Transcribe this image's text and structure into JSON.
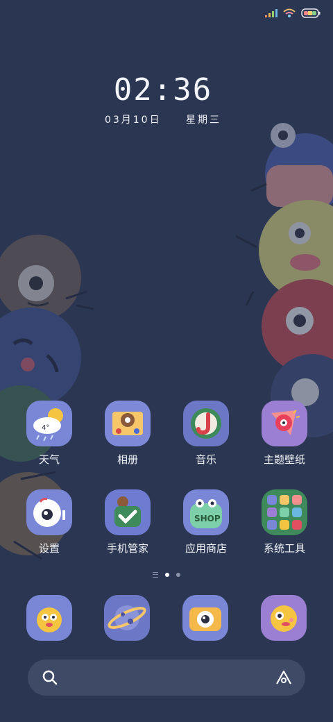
{
  "status_bar": {
    "signal_icon": "signal-icon",
    "wifi_icon": "wifi-icon",
    "battery_icon": "battery-icon"
  },
  "clock": {
    "time": "02:36",
    "date": "03月10日",
    "weekday": "星期三"
  },
  "apps": [
    {
      "label": "天气",
      "icon": "weather-icon",
      "color": "#7a86d6"
    },
    {
      "label": "相册",
      "icon": "gallery-icon",
      "color": "#7e8ad8"
    },
    {
      "label": "音乐",
      "icon": "music-icon",
      "color": "#6c78c6"
    },
    {
      "label": "主题壁纸",
      "icon": "theme-icon",
      "color": "#9a7fd2"
    },
    {
      "label": "设置",
      "icon": "settings-icon",
      "color": "#7a86d6"
    },
    {
      "label": "手机管家",
      "icon": "security-icon",
      "color": "#6f7bd0"
    },
    {
      "label": "应用商店",
      "icon": "app-store-icon",
      "color": "#7a86d6"
    },
    {
      "label": "系统工具",
      "icon": "tools-folder-icon",
      "color": "#3f8a5a"
    }
  ],
  "page_indicator": {
    "pages": 2,
    "current": 1
  },
  "dock": [
    {
      "icon": "phone-icon",
      "color": "#7a86d6"
    },
    {
      "icon": "browser-icon",
      "color": "#6c78c6"
    },
    {
      "icon": "camera-icon",
      "color": "#7a86d6"
    },
    {
      "icon": "messages-icon",
      "color": "#9a7fd2"
    }
  ],
  "search_bar": {
    "search_icon": "search-icon",
    "assistant_icon": "assistant-icon"
  }
}
